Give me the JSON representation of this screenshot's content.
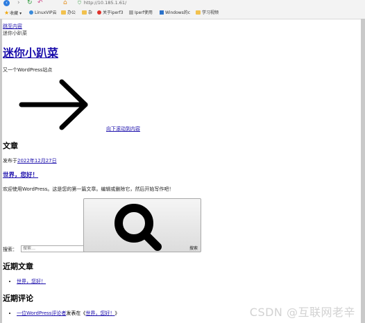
{
  "browser": {
    "url": "http://10.185.1.61/",
    "bookmarks": [
      {
        "label": "收藏",
        "icon": "star-icon"
      },
      {
        "label": "LinuxVIP云",
        "icon": "globe-icon"
      },
      {
        "label": "办公",
        "icon": "folder-icon"
      },
      {
        "label": "杂",
        "icon": "folder-icon"
      },
      {
        "label": "关于iperf3",
        "icon": "favicon-icon"
      },
      {
        "label": "Iperf使用",
        "icon": "favicon-icon"
      },
      {
        "label": "Windows的c",
        "icon": "windows-icon"
      },
      {
        "label": "学习视频",
        "icon": "folder-icon"
      }
    ]
  },
  "page": {
    "skip_link": "跳至内容",
    "logo_alt": "迷你小趴菜",
    "site_title": "迷你小趴菜",
    "tagline": "又一个WordPress站点",
    "scroll_link": "向下滚动到内容",
    "articles_heading": "文章",
    "posted_prefix": "发布于",
    "posted_date": "2022年12月27日",
    "post_title": "世界，您好！",
    "excerpt": "欢迎使用WordPress。这是您的第一篇文章。编辑或删除它，然后开始写作吧！",
    "search_label": "搜索：",
    "search_placeholder": "搜索…",
    "search_button": "搜索",
    "recent_posts_heading": "近期文章",
    "recent_posts": [
      "世界，您好！"
    ],
    "recent_comments_heading": "近期评论",
    "comment_author": "一位WordPress评论者",
    "comment_on": "发表在《",
    "comment_post": "世界，您好！",
    "comment_close": "》"
  },
  "watermark": "CSDN @互联网老辛"
}
